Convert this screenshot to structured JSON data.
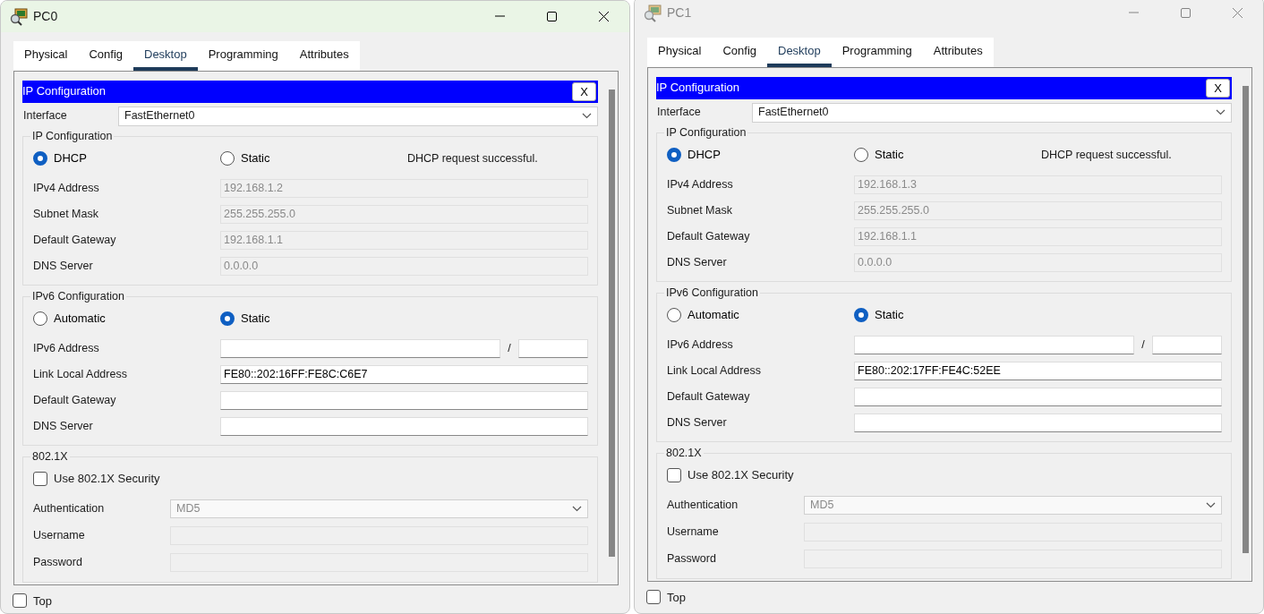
{
  "windows": [
    {
      "title": "PC0",
      "active": true,
      "tabs": [
        {
          "label": "Physical",
          "selected": false
        },
        {
          "label": "Config",
          "selected": false
        },
        {
          "label": "Desktop",
          "selected": true
        },
        {
          "label": "Programming",
          "selected": false
        },
        {
          "label": "Attributes",
          "selected": false
        }
      ],
      "panel_title": "IP Configuration",
      "close_label": "X",
      "interface_label": "Interface",
      "interface_value": "FastEthernet0",
      "ipv4": {
        "legend": "IP Configuration",
        "modes": [
          {
            "label": "DHCP",
            "selected": true
          },
          {
            "label": "Static",
            "selected": false
          }
        ],
        "status": "DHCP request successful.",
        "fields": [
          {
            "label": "IPv4 Address",
            "value": "192.168.1.2",
            "disabled": true
          },
          {
            "label": "Subnet Mask",
            "value": "255.255.255.0",
            "disabled": true
          },
          {
            "label": "Default Gateway",
            "value": "192.168.1.1",
            "disabled": true
          },
          {
            "label": "DNS Server",
            "value": "0.0.0.0",
            "disabled": true
          }
        ]
      },
      "ipv6": {
        "legend": "IPv6 Configuration",
        "modes": [
          {
            "label": "Automatic",
            "selected": false
          },
          {
            "label": "Static",
            "selected": true
          }
        ],
        "fields": [
          {
            "kind": "prefix",
            "label": "IPv6 Address",
            "separator": "/",
            "disabled": false
          },
          {
            "kind": "text",
            "label": "Link Local Address",
            "value": "FE80::202:16FF:FE8C:C6E7",
            "disabled": false
          },
          {
            "kind": "text",
            "label": "Default Gateway",
            "disabled": false
          },
          {
            "kind": "text",
            "label": "DNS Server",
            "disabled": false
          }
        ]
      },
      "dot1x": {
        "legend": "802.1X",
        "security": {
          "label": "Use 802.1X Security",
          "checked": false
        },
        "fields": [
          {
            "kind": "select",
            "label": "Authentication",
            "value": "MD5",
            "disabled": true
          },
          {
            "kind": "text",
            "label": "Username",
            "disabled": true
          },
          {
            "kind": "text",
            "label": "Password",
            "disabled": true
          }
        ]
      },
      "top": {
        "label": "Top",
        "checked": false
      }
    },
    {
      "title": "PC1",
      "active": false,
      "tabs": [
        {
          "label": "Physical",
          "selected": false
        },
        {
          "label": "Config",
          "selected": false
        },
        {
          "label": "Desktop",
          "selected": true
        },
        {
          "label": "Programming",
          "selected": false
        },
        {
          "label": "Attributes",
          "selected": false
        }
      ],
      "panel_title": "IP Configuration",
      "close_label": "X",
      "interface_label": "Interface",
      "interface_value": "FastEthernet0",
      "ipv4": {
        "legend": "IP Configuration",
        "modes": [
          {
            "label": "DHCP",
            "selected": true
          },
          {
            "label": "Static",
            "selected": false
          }
        ],
        "status": "DHCP request successful.",
        "fields": [
          {
            "label": "IPv4 Address",
            "value": "192.168.1.3",
            "disabled": true
          },
          {
            "label": "Subnet Mask",
            "value": "255.255.255.0",
            "disabled": true
          },
          {
            "label": "Default Gateway",
            "value": "192.168.1.1",
            "disabled": true
          },
          {
            "label": "DNS Server",
            "value": "0.0.0.0",
            "disabled": true
          }
        ]
      },
      "ipv6": {
        "legend": "IPv6 Configuration",
        "modes": [
          {
            "label": "Automatic",
            "selected": false
          },
          {
            "label": "Static",
            "selected": true
          }
        ],
        "fields": [
          {
            "kind": "prefix",
            "label": "IPv6 Address",
            "separator": "/",
            "disabled": false
          },
          {
            "kind": "text",
            "label": "Link Local Address",
            "value": "FE80::202:17FF:FE4C:52EE",
            "disabled": false
          },
          {
            "kind": "text",
            "label": "Default Gateway",
            "disabled": false
          },
          {
            "kind": "text",
            "label": "DNS Server",
            "disabled": false
          }
        ]
      },
      "dot1x": {
        "legend": "802.1X",
        "security": {
          "label": "Use 802.1X Security",
          "checked": false
        },
        "fields": [
          {
            "kind": "select",
            "label": "Authentication",
            "value": "MD5",
            "disabled": true
          },
          {
            "kind": "text",
            "label": "Username",
            "disabled": true
          },
          {
            "kind": "text",
            "label": "Password",
            "disabled": true
          }
        ]
      },
      "top": {
        "label": "Top",
        "checked": false
      }
    }
  ]
}
